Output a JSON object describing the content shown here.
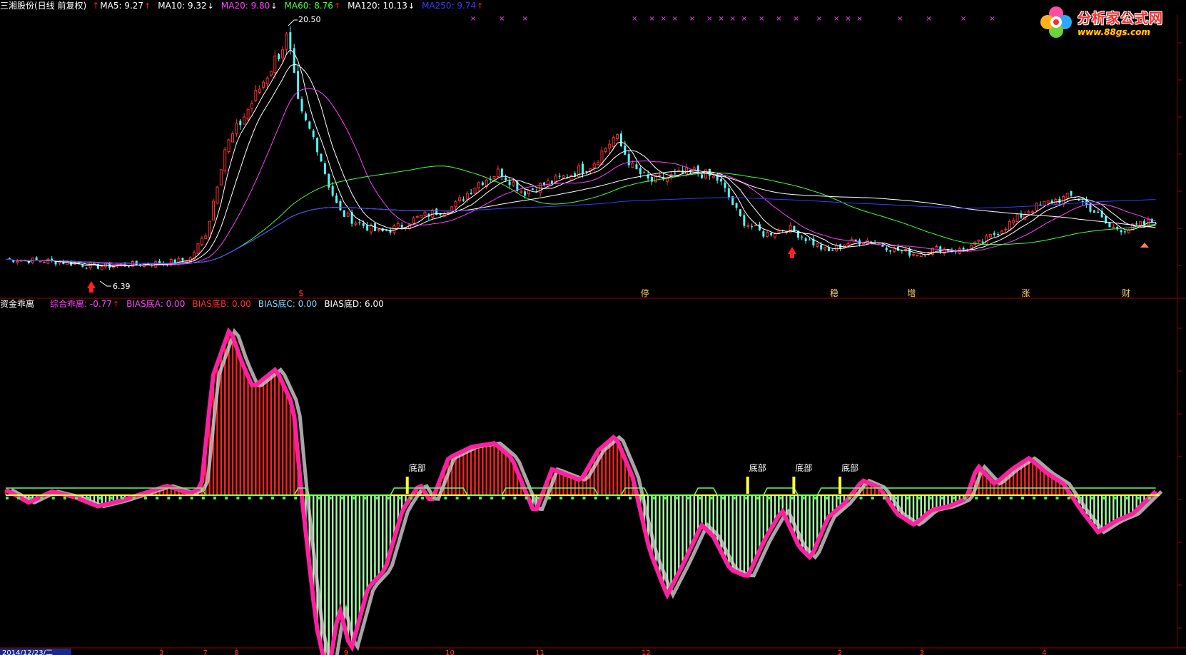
{
  "main_panel": {
    "title": "三湘股份(日线 前复权)",
    "indicators": [
      {
        "label": "MA5: 9.27",
        "arrow": "↑",
        "color": "#ffffff"
      },
      {
        "label": "MA10: 9.32",
        "arrow": "↓",
        "color": "#ffffff"
      },
      {
        "label": "MA20: 9.80",
        "arrow": "↓",
        "color": "#ff40ff"
      },
      {
        "label": "MA60: 8.76",
        "arrow": "↑",
        "color": "#40ff40"
      },
      {
        "label": "MA120: 10.13",
        "arrow": "↓",
        "color": "#ffffff"
      },
      {
        "label": "MA250: 9.74",
        "arrow": "↑",
        "color": "#3a3aff"
      }
    ],
    "high_label": "20.50",
    "low_label": "6.39",
    "markers": [
      {
        "text": "$",
        "x_frac": 0.256
      },
      {
        "text": "停",
        "x_frac": 0.554
      },
      {
        "text": "稳",
        "x_frac": 0.718
      },
      {
        "text": "增",
        "x_frac": 0.785
      },
      {
        "text": "涨",
        "x_frac": 0.884
      },
      {
        "text": "财",
        "x_frac": 0.971
      }
    ]
  },
  "sub_panel": {
    "title": "资金乖离",
    "indicators": [
      {
        "label": "综合乖离: -0.77",
        "arrow": "↑",
        "color": "#ff40ff"
      },
      {
        "label": "BIAS底A: 0.00",
        "arrow": "",
        "color": "#ff40ff"
      },
      {
        "label": "BIAS底B: 0.00",
        "arrow": "",
        "color": "#ff3030"
      },
      {
        "label": "BIAS底C: 0.00",
        "arrow": "",
        "color": "#7fd7ff"
      },
      {
        "label": "BIAS底D: 6.00",
        "arrow": "",
        "color": "#ffffff"
      }
    ],
    "bottom_labels": [
      "底部",
      "底部",
      "底部",
      "底部"
    ]
  },
  "date_axis": {
    "first_date": "2014/12/23/二",
    "month_ticks": [
      "3",
      "7",
      "8",
      "9",
      "10",
      "11",
      "12",
      "2",
      "3",
      "4"
    ]
  },
  "logo": {
    "name": "分析家公式网",
    "url": "www.88gs.com"
  },
  "colors": {
    "up": "#ff3232",
    "down": "#54fcfc",
    "ma5": "#ffffff",
    "ma10": "#ffffff",
    "ma20": "#ff40ff",
    "ma60": "#40ff40",
    "ma120": "#ffffff",
    "ma250": "#3a3aff",
    "panel_border": "#a00000"
  }
}
